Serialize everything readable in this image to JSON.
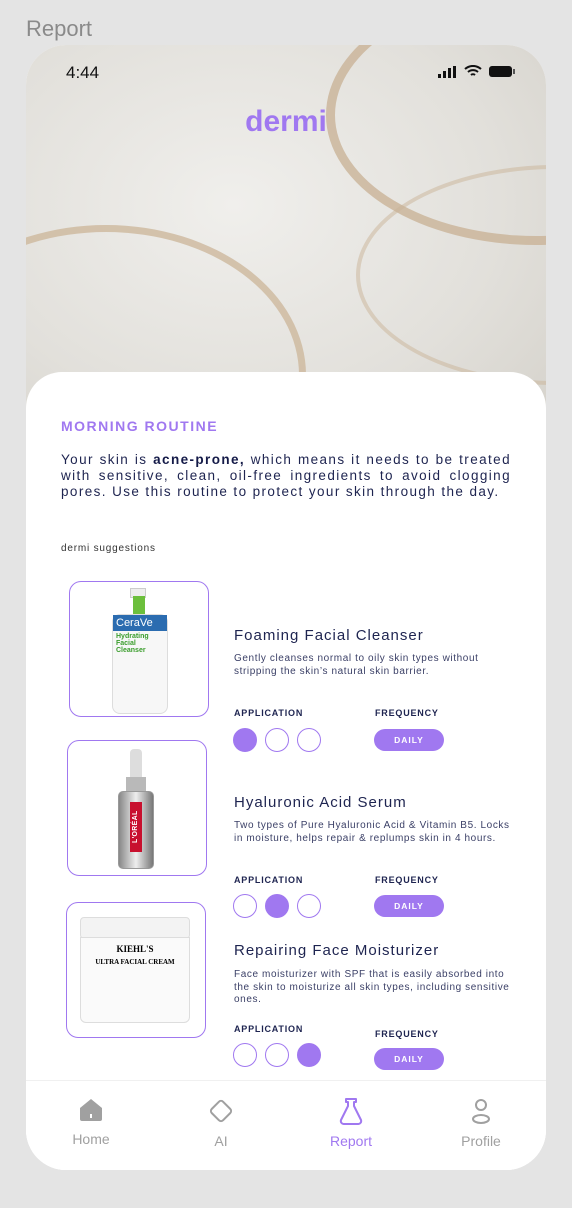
{
  "frame_label": "Report",
  "status": {
    "time": "4:44"
  },
  "brand": "dermi",
  "routine": {
    "title": "MORNING ROUTINE",
    "intro_pre": "Your skin is ",
    "intro_bold": "acne-prone,",
    "intro_post": " which means it needs to be treated with sensitive, clean, oil-free ingredients to avoid clogging pores. Use this routine to protect your skin through the day.",
    "suggestions_label": "dermi suggestions"
  },
  "products": [
    {
      "name": "Foaming Facial Cleanser",
      "description": "Gently cleanses normal to oily skin types without stripping the skin’s natural skin barrier.",
      "application_label": "APPLICATION",
      "frequency_label": "FREQUENCY",
      "application_step": 1,
      "frequency": "DAILY",
      "image_brand": "CeraVe",
      "image_text": "Hydrating Facial Cleanser"
    },
    {
      "name": "Hyaluronic Acid Serum",
      "description": "Two types of Pure Hyaluronic Acid & Vitamin B5. Locks in moisture, helps repair & replumps skin in 4 hours.",
      "application_label": "APPLICATION",
      "frequency_label": "FREQUENCY",
      "application_step": 2,
      "frequency": "DAILY",
      "image_brand": "L'ORÉAL"
    },
    {
      "name": "Repairing Face Moisturizer",
      "description": "Face moisturizer with SPF that is easily absorbed into the skin to moisturize all skin types, including sensitive ones.",
      "application_label": "APPLICATION",
      "frequency_label": "FREQUENCY",
      "application_step": 3,
      "frequency": "DAILY",
      "image_brand": "KIEHL'S",
      "image_text": "ULTRA FACIAL CREAM"
    }
  ],
  "nav": {
    "items": [
      {
        "label": "Home",
        "icon": "home-icon"
      },
      {
        "label": "AI",
        "icon": "diamond-icon"
      },
      {
        "label": "Report",
        "icon": "flask-icon",
        "active": true
      },
      {
        "label": "Profile",
        "icon": "person-icon"
      }
    ]
  },
  "colors": {
    "accent": "#a078f0",
    "text": "#1e2450",
    "inactive": "#a0a0a0"
  }
}
